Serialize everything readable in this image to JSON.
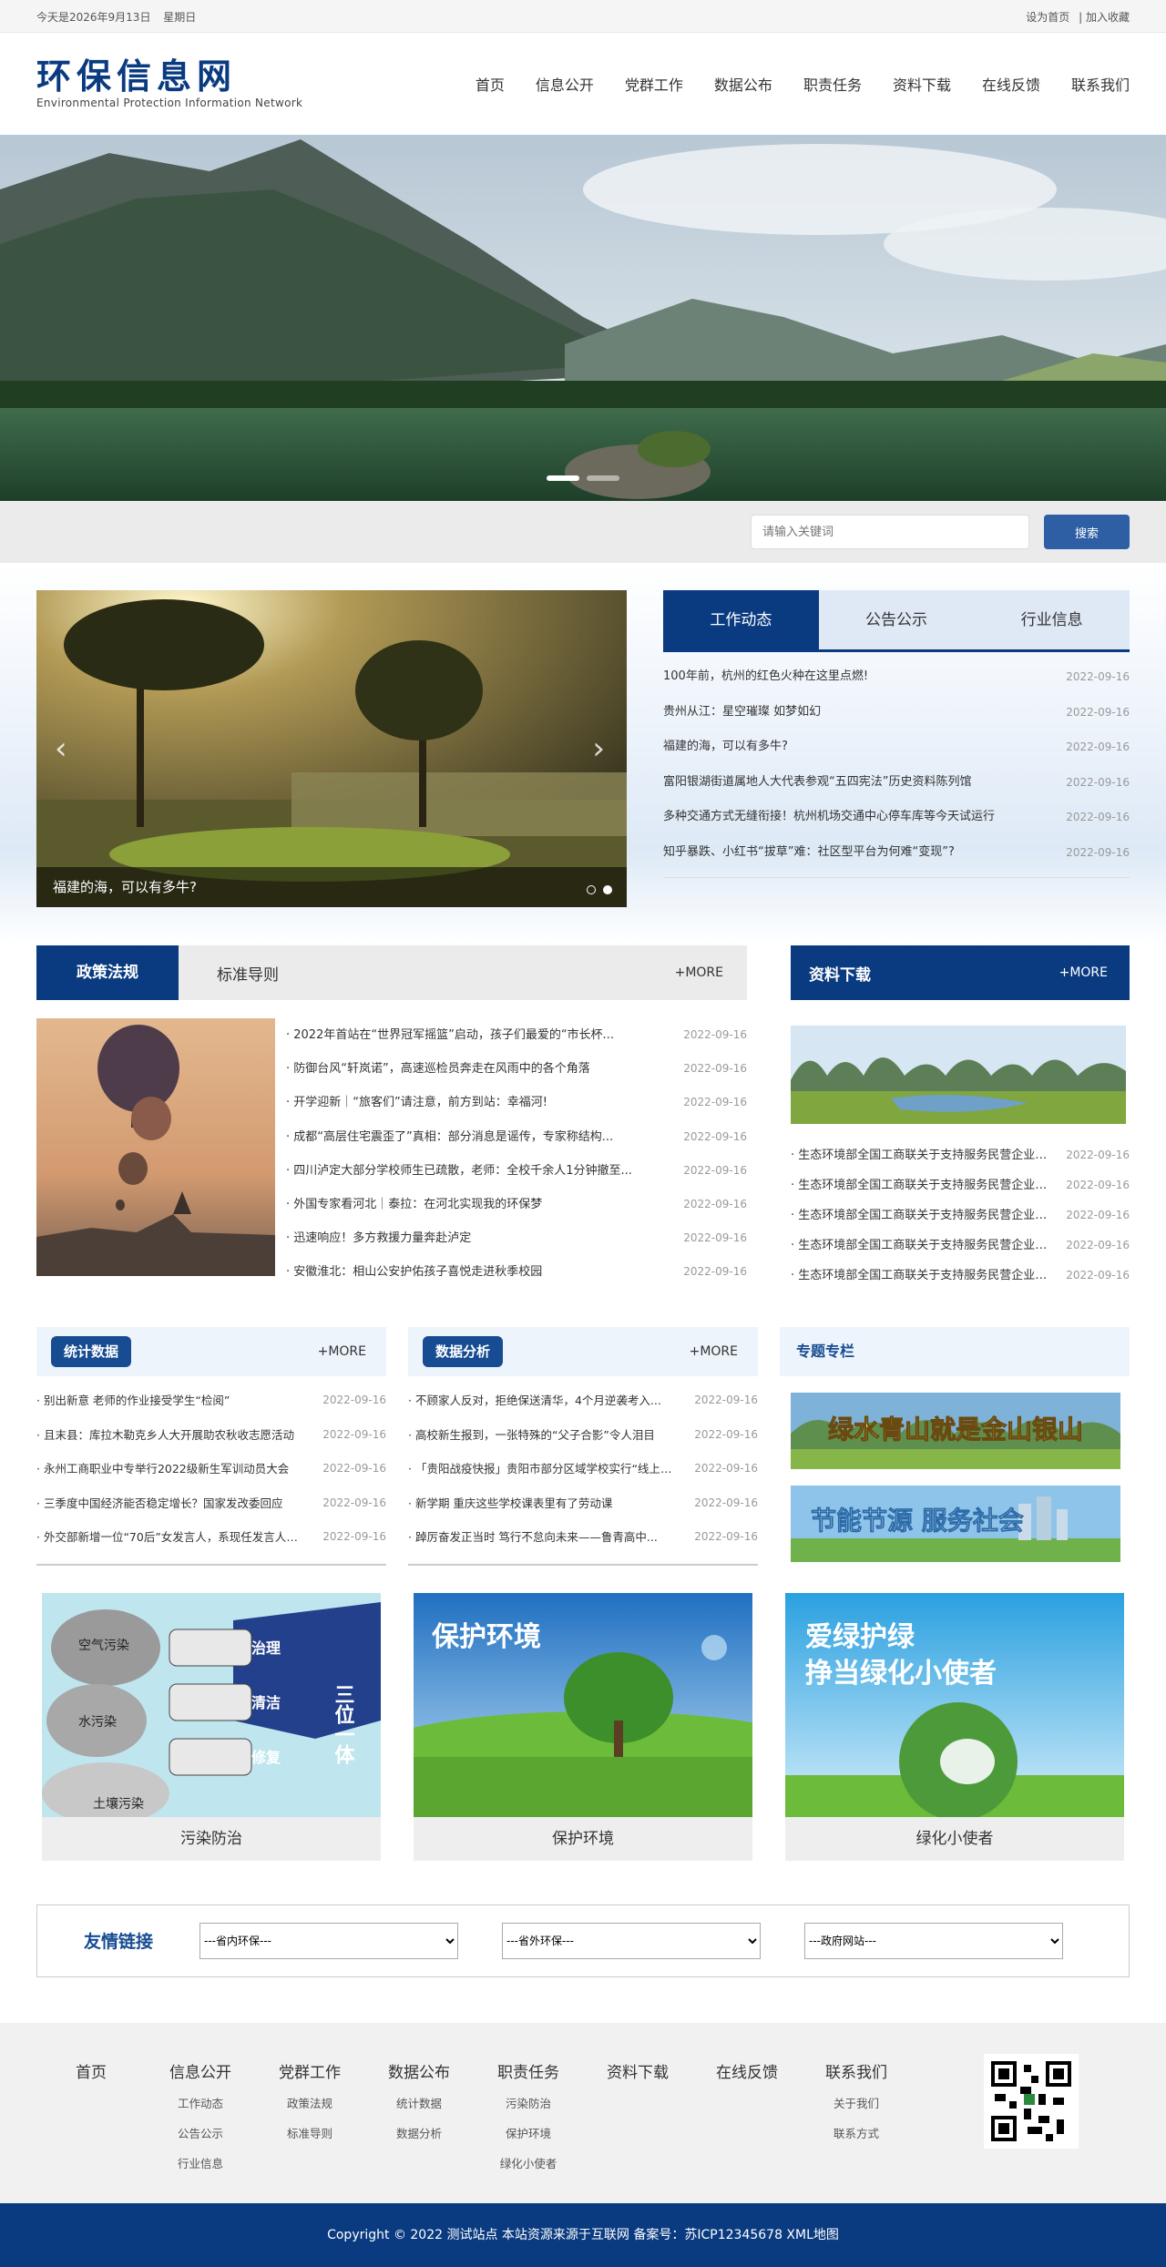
{
  "topbar": {
    "date_text": "今天是2026年9月13日",
    "weekday": "星期日",
    "set_home": "设为首页",
    "sep": "|",
    "add_fav": "加入收藏"
  },
  "header": {
    "logo_cn": "环保信息网",
    "logo_en": "Environmental Protection Information Network",
    "nav": [
      "首页",
      "信息公开",
      "党群工作",
      "数据公布",
      "职责任务",
      "资料下载",
      "在线反馈",
      "联系我们"
    ]
  },
  "search": {
    "placeholder": "请输入关键词",
    "button": "搜索"
  },
  "slider": {
    "caption": "福建的海，可以有多牛?"
  },
  "news": {
    "tabs": [
      "工作动态",
      "公告公示",
      "行业信息"
    ],
    "items": [
      {
        "title": "100年前，杭州的红色火种在这里点燃!",
        "date": "2022-09-16"
      },
      {
        "title": "贵州从江：星空璀璨 如梦如幻",
        "date": "2022-09-16"
      },
      {
        "title": "福建的海，可以有多牛?",
        "date": "2022-09-16"
      },
      {
        "title": "富阳银湖街道属地人大代表参观“五四宪法”历史资料陈列馆",
        "date": "2022-09-16"
      },
      {
        "title": "多种交通方式无缝衔接！杭州机场交通中心停车库等今天试运行",
        "date": "2022-09-16"
      },
      {
        "title": "知乎暴跌、小红书“拔草”难：社区型平台为何难“变现”?",
        "date": "2022-09-16"
      }
    ]
  },
  "policy": {
    "tab_active": "政策法规",
    "tab_other": "标准导则",
    "more": "+MORE",
    "items": [
      {
        "title": "· 2022年首站在“世界冠军摇篮”启动，孩子们最爱的“市长杯...",
        "date": "2022-09-16"
      },
      {
        "title": "· 防御台风“轩岚诺”，高速巡检员奔走在风雨中的各个角落",
        "date": "2022-09-16"
      },
      {
        "title": "· 开学迎新｜“旅客们”请注意，前方到站：幸福河!",
        "date": "2022-09-16"
      },
      {
        "title": "· 成都“高层住宅震歪了”真相：部分消息是谣传，专家称结构...",
        "date": "2022-09-16"
      },
      {
        "title": "· 四川泸定大部分学校师生已疏散，老师：全校千余人1分钟撤至...",
        "date": "2022-09-16"
      },
      {
        "title": "· 外国专家看河北｜泰拉：在河北实现我的环保梦",
        "date": "2022-09-16"
      },
      {
        "title": "· 迅速响应！多方救援力量奔赴泸定",
        "date": "2022-09-16"
      },
      {
        "title": "· 安徽淮北：相山公安护佑孩子喜悦走进秋季校园",
        "date": "2022-09-16"
      }
    ]
  },
  "download": {
    "title": "资料下载",
    "more": "+MORE",
    "items": [
      {
        "title": "· 生态环境部全国工商联关于支持服务民营企业绿色发展的意见",
        "date": "2022-09-16"
      },
      {
        "title": "· 生态环境部全国工商联关于支持服务民营企业绿色发展的意见",
        "date": "2022-09-16"
      },
      {
        "title": "· 生态环境部全国工商联关于支持服务民营企业绿色发展的意见",
        "date": "2022-09-16"
      },
      {
        "title": "· 生态环境部全国工商联关于支持服务民营企业绿色发展的意见",
        "date": "2022-09-16"
      },
      {
        "title": "· 生态环境部全国工商联关于支持服务民营企业绿色发展的意见",
        "date": "2022-09-16"
      }
    ]
  },
  "stats": {
    "title": "统计数据",
    "more": "+MORE",
    "items": [
      {
        "title": "· 别出新意 老师的作业接受学生“检阅”",
        "date": "2022-09-16"
      },
      {
        "title": "· 且末县：库拉木勒克乡人大开展助农秋收志愿活动",
        "date": "2022-09-16"
      },
      {
        "title": "· 永州工商职业中专举行2022级新生军训动员大会",
        "date": "2022-09-16"
      },
      {
        "title": "· 三季度中国经济能否稳定增长？国家发改委回应",
        "date": "2022-09-16"
      },
      {
        "title": "· 外交部新增一位“70后”女发言人，系现任发言人中...",
        "date": "2022-09-16"
      }
    ]
  },
  "analysis": {
    "title": "数据分析",
    "more": "+MORE",
    "items": [
      {
        "title": "· 不顾家人反对，拒绝保送清华，4个月逆袭考入...",
        "date": "2022-09-16"
      },
      {
        "title": "· 高校新生报到，一张特殊的“父子合影”令人泪目",
        "date": "2022-09-16"
      },
      {
        "title": "· 「贵阳战疫快报」贵阳市部分区域学校实行“线上教学”",
        "date": "2022-09-16"
      },
      {
        "title": "· 新学期 重庆这些学校课表里有了劳动课",
        "date": "2022-09-16"
      },
      {
        "title": "· 踔厉奋发正当时 笃行不怠向未来——鲁青高中...",
        "date": "2022-09-16"
      }
    ]
  },
  "special": {
    "title": "专题专栏",
    "banner1": "绿水青山就是金山银山",
    "banner2": "节能节源 服务社会"
  },
  "cards": [
    {
      "caption": "污染防治",
      "img": {
        "tags": [
          "空气污染",
          "水污染",
          "土壤污染",
          "治理",
          "清洁",
          "修复",
          "三位一体"
        ]
      }
    },
    {
      "caption": "保护环境",
      "img": {
        "text": "保护环境"
      }
    },
    {
      "caption": "绿化小使者",
      "img": {
        "line1": "爱绿护绿",
        "line2": "挣当绿化小使者"
      }
    }
  ],
  "links": {
    "title": "友情链接",
    "selects": [
      "---省内环保---",
      "---省外环保---",
      "---政府网站---"
    ]
  },
  "footer": {
    "cols": [
      {
        "head": "首页",
        "subs": []
      },
      {
        "head": "信息公开",
        "subs": [
          "工作动态",
          "公告公示",
          "行业信息"
        ]
      },
      {
        "head": "党群工作",
        "subs": [
          "政策法规",
          "标准导则"
        ]
      },
      {
        "head": "数据公布",
        "subs": [
          "统计数据",
          "数据分析"
        ]
      },
      {
        "head": "职责任务",
        "subs": [
          "污染防治",
          "保护环境",
          "绿化小使者"
        ]
      },
      {
        "head": "资料下载",
        "subs": []
      },
      {
        "head": "在线反馈",
        "subs": []
      },
      {
        "head": "联系我们",
        "subs": [
          "关于我们",
          "联系方式"
        ]
      }
    ],
    "copyright": "Copyright © 2022 测试站点 本站资源来源于互联网 备案号：苏ICP12345678 XML地图"
  },
  "colors": {
    "primary": "#0a3b80",
    "accent": "#2e5fa5"
  }
}
